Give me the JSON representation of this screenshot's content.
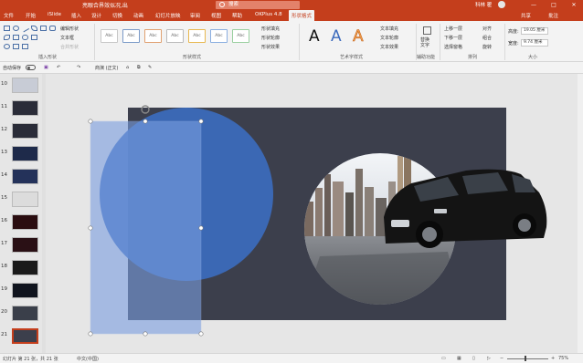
{
  "window": {
    "title": "亮眼合界效似况,出",
    "search_placeholder": "搜索",
    "user": "科林 瞿",
    "min": "—",
    "restore": "□",
    "close": "✕"
  },
  "tabs": [
    "文件",
    "开始",
    "iSlide",
    "插入",
    "设计",
    "切换",
    "动画",
    "幻灯片放映",
    "审阅",
    "视图",
    "帮助",
    "OKPlus 4.8",
    "形状格式"
  ],
  "share_label": "共享",
  "comment_label": "批注",
  "ribbon": {
    "insert_shapes": {
      "label": "插入形状",
      "edit_shape": "编辑形状",
      "text_box": "文本框",
      "merge_shapes": "合并形状"
    },
    "shape_styles": {
      "label": "形状样式",
      "samples": [
        "Abc",
        "Abc",
        "Abc",
        "Abc",
        "Abc",
        "Abc",
        "Abc"
      ],
      "fill": "形状填充",
      "outline": "形状轮廓",
      "effects": "形状效果"
    },
    "wordart": {
      "label": "艺术字样式",
      "samples": [
        "A",
        "A",
        "A"
      ],
      "text_fill": "文本填充",
      "text_outline": "文本轮廓",
      "text_effects": "文本效果"
    },
    "accessibility": {
      "label": "辅助功能",
      "alt_text": "替换文字"
    },
    "arrange": {
      "label": "排列",
      "bring_forward": "上移一层",
      "send_backward": "下移一层",
      "selection_pane": "选择窗格",
      "align": "对齐",
      "group": "组合",
      "rotate": "旋转"
    },
    "size": {
      "label": "大小",
      "height_label": "高度:",
      "height_value": "19.05 厘米",
      "width_label": "宽度:",
      "width_value": "9.74 厘米"
    }
  },
  "quick_access": {
    "autosave": "自动保存",
    "font_size_label": "商演 (正文)"
  },
  "thumbnails": [
    {
      "num": "10",
      "color": "#c8ccd6"
    },
    {
      "num": "11",
      "color": "#2a2c38"
    },
    {
      "num": "12",
      "color": "#2a2c38"
    },
    {
      "num": "13",
      "color": "#1e2a4a"
    },
    {
      "num": "14",
      "color": "#24325a"
    },
    {
      "num": "15",
      "color": "#dcdcdc"
    },
    {
      "num": "16",
      "color": "#2a0d10"
    },
    {
      "num": "17",
      "color": "#2a1015"
    },
    {
      "num": "18",
      "color": "#1a1a1a"
    },
    {
      "num": "19",
      "color": "#10141e"
    },
    {
      "num": "20",
      "color": "#3a3f4a"
    },
    {
      "num": "21",
      "color": "#3c3f4c"
    }
  ],
  "status": {
    "slide_info": "幻灯片 第 21 张，共 21 张",
    "language": "中文(中国)",
    "zoom": "75%"
  },
  "colors": {
    "brand": "#c43e1c",
    "slide_bg": "#3c3f4c",
    "circle_blue": "#3c6bbd",
    "rect_blue": "#7a9ee0"
  }
}
